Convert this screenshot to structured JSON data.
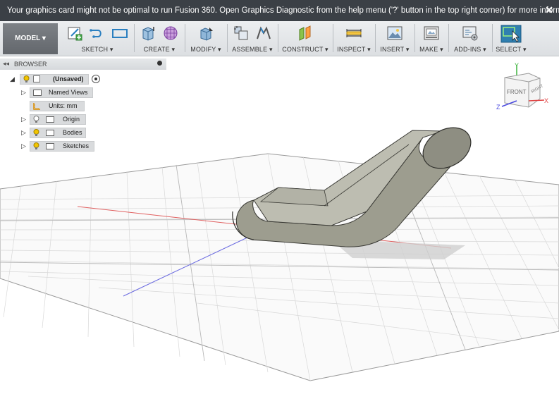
{
  "notification": {
    "message": "Your graphics card might not be optimal to run Fusion 360. Open Graphics Diagnostic from the help menu ('?' button in the top right corner) for more information",
    "close_glyph": "✕"
  },
  "toolbar": {
    "workspace": "MODEL ▾",
    "groups": [
      {
        "label": "SKETCH ▾",
        "icons": [
          "create-sketch-icon",
          "spline-icon",
          "rectangle-icon"
        ]
      },
      {
        "label": "CREATE ▾",
        "icons": [
          "extrude-box-icon",
          "form-sphere-icon"
        ]
      },
      {
        "label": "MODIFY ▾",
        "icons": [
          "press-pull-icon"
        ]
      },
      {
        "label": "ASSEMBLE ▾",
        "icons": [
          "new-component-icon",
          "joint-icon"
        ]
      },
      {
        "label": "CONSTRUCT ▾",
        "icons": [
          "offset-plane-icon"
        ]
      },
      {
        "label": "INSPECT ▾",
        "icons": [
          "measure-icon"
        ]
      },
      {
        "label": "INSERT ▾",
        "icons": [
          "insert-image-icon"
        ]
      },
      {
        "label": "MAKE ▾",
        "icons": [
          "print-3d-icon"
        ]
      },
      {
        "label": "ADD-INS ▾",
        "icons": [
          "scripts-addins-icon"
        ]
      },
      {
        "label": "SELECT ▾",
        "icons": [
          "select-cursor-icon"
        ]
      }
    ]
  },
  "browser": {
    "title": "BROWSER",
    "root": "(Unsaved)",
    "items": [
      "Named Views",
      "Units: mm",
      "Origin",
      "Bodies",
      "Sketches"
    ]
  },
  "viewcube": {
    "front": "FRONT",
    "right": "RIGHT",
    "x": "X",
    "y": "Y",
    "z": "Z"
  },
  "colors": {
    "accent_select": "#2f7fb0",
    "bulb": "#f2c500",
    "body": "#a8a89c"
  }
}
